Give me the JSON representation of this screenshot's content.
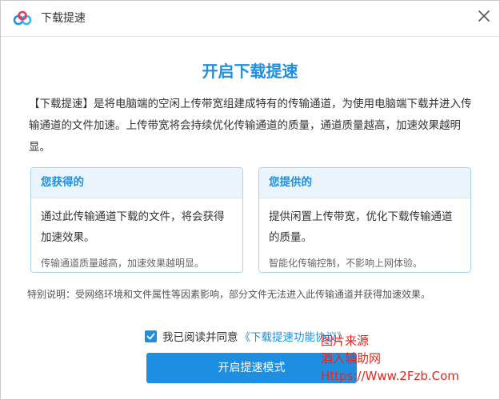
{
  "window": {
    "title": "下载提速",
    "icon": "baidu-netdisk-cloud-icon",
    "close_icon": "close-icon"
  },
  "main": {
    "heading": "开启下载提速",
    "intro": "【下载提速】是将电脑端的空闲上传带宽组建成特有的传输通道，为使用电脑端下载并进入传输通道的文件加速。上传带宽将会持续优化传输通道的质量，通道质量越高，加速效果越明显。",
    "cards": [
      {
        "title": "您获得的",
        "body": "通过此传输通道下载的文件，将会获得加速效果。",
        "note": "传输通道质量越高，加速效果越明显。"
      },
      {
        "title": "您提供的",
        "body": "提供闲置上传带宽，优化下载传输通道的质量。",
        "note": "智能化传输控制，不影响上网体验。"
      }
    ],
    "special_note": "特别说明：受网络环境和文件属性等因素影响，部分文件无法进入此传输通道并获得加速效果。"
  },
  "agreement": {
    "checked": true,
    "label": "我已阅读并同意",
    "link": "《下载提速功能协议》"
  },
  "actions": {
    "primary": "开启提速模式"
  },
  "watermark": {
    "line1": "图片来源",
    "line2": "酒入辅助网",
    "line3": "Https://Www.2Fzb.Com"
  },
  "colors": {
    "accent": "#1e8fe0",
    "card_border": "#a8d3f5",
    "card_header_bg": "#eaf4fd",
    "watermark": "#e8231e"
  }
}
